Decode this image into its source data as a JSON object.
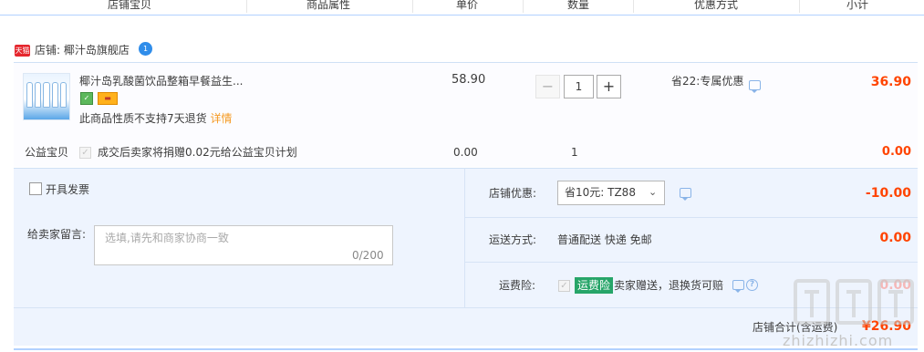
{
  "header": {
    "cols": [
      "店铺宝贝",
      "商品属性",
      "单价",
      "数量",
      "优惠方式",
      "小计"
    ]
  },
  "shop": {
    "tmall_badge": "天猫",
    "name": "店铺: 椰汁岛旗舰店",
    "ww_badge": "1"
  },
  "item": {
    "title": "椰汁岛乳酸菌饮品整箱早餐益生...",
    "notice": "此商品性质不支持7天退货",
    "notice_link": "详情",
    "price": "58.90",
    "quantity": "1",
    "minus": "−",
    "plus": "+",
    "promo": "省22:专属优惠",
    "subtotal": "36.90"
  },
  "charity": {
    "label": "公益宝贝",
    "text": "成交后卖家将捐赠0.02元给公益宝贝计划",
    "price": "0.00",
    "quantity": "1",
    "subtotal": "0.00"
  },
  "options": {
    "invoice_label": "开具发票",
    "message_label": "给卖家留言:",
    "message_placeholder": "选填,请先和商家协商一致",
    "message_count": "0/200",
    "coupon_label": "店铺优惠:",
    "coupon_value": "省10元: TZ88",
    "coupon_amount": "-10.00",
    "shipping_label": "运送方式:",
    "shipping_value": "普通配送 快递 免邮",
    "shipping_amount": "0.00",
    "insurance_label": "运费险:",
    "insurance_badge": "运费险",
    "insurance_text": "卖家赠送，退换货可赔",
    "insurance_amount": "0.00"
  },
  "total": {
    "label": "店铺合计(含运费)",
    "amount": "¥26.90"
  },
  "watermark": {
    "text": "zhizhizhi.com"
  },
  "colors": {
    "accent_red": "#ff4400",
    "border_blue": "#b2d1ff",
    "option_bg": "#eef4fe",
    "insurance_green": "#27a569"
  }
}
